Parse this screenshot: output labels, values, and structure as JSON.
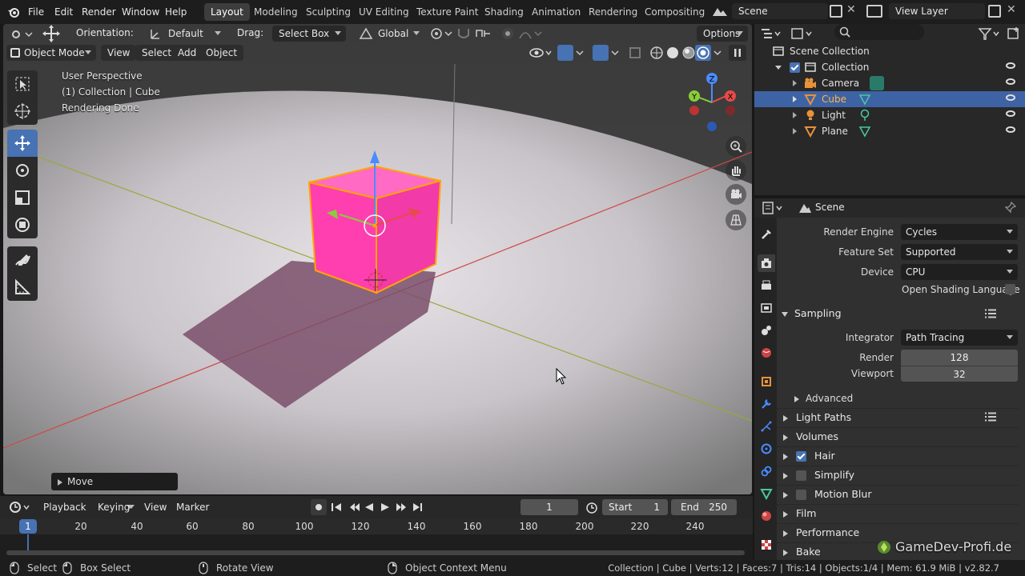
{
  "menus": [
    "File",
    "Edit",
    "Render",
    "Window",
    "Help"
  ],
  "workspaces": [
    "Layout",
    "Modeling",
    "Sculpting",
    "UV Editing",
    "Texture Paint",
    "Shading",
    "Animation",
    "Rendering",
    "Compositing"
  ],
  "scene_name": "Scene",
  "view_layer": "View Layer",
  "toolbar": {
    "orientation_label": "Orientation:",
    "orientation_value": "Default",
    "drag_label": "Drag:",
    "drag_value": "Select Box",
    "transform_value": "Global",
    "options_label": "Options"
  },
  "viewport_header": {
    "mode": "Object Mode",
    "menus": [
      "View",
      "Select",
      "Add",
      "Object"
    ]
  },
  "overlay": {
    "line1": "User Perspective",
    "line2": "(1) Collection | Cube",
    "line3": "Rendering Done"
  },
  "last_op": "Move",
  "outliner": {
    "root": "Scene Collection",
    "collection": "Collection",
    "items": [
      "Camera",
      "Cube",
      "Light",
      "Plane"
    ],
    "selected": "Cube"
  },
  "properties": {
    "context": "Scene",
    "render_engine_label": "Render Engine",
    "render_engine": "Cycles",
    "feature_set_label": "Feature Set",
    "feature_set": "Supported",
    "device_label": "Device",
    "device": "CPU",
    "osl_label": "Open Shading Language",
    "sampling": "Sampling",
    "integrator_label": "Integrator",
    "integrator": "Path Tracing",
    "render_label": "Render",
    "render_samples": "128",
    "viewport_label": "Viewport",
    "viewport_samples": "32",
    "advanced": "Advanced",
    "light_paths": "Light Paths",
    "volumes": "Volumes",
    "hair": "Hair",
    "simplify": "Simplify",
    "motion_blur": "Motion Blur",
    "film": "Film",
    "performance": "Performance",
    "bake": "Bake"
  },
  "watermark": "GameDev-Profi.de",
  "timeline": {
    "menus": [
      "Playback",
      "Keying",
      "View",
      "Marker"
    ],
    "current_frame": "1",
    "start_label": "Start",
    "start": "1",
    "end_label": "End",
    "end": "250",
    "ticks": [
      "20",
      "40",
      "60",
      "80",
      "100",
      "120",
      "140",
      "160",
      "180",
      "200",
      "220",
      "240"
    ],
    "cursor_frame": "1"
  },
  "statusbar": {
    "select": "Select",
    "box_select": "Box Select",
    "rotate_view": "Rotate View",
    "context_menu": "Object Context Menu",
    "stats": "Collection | Cube | Verts:12 | Faces:7 | Tris:14 | Objects:1/4 | Mem: 61.9 MiB | v2.82.7"
  },
  "colors": {
    "accent": "#4772b3",
    "selection": "#3e63a4",
    "cube": "#ff3fb0",
    "outline": "#ffa500"
  }
}
